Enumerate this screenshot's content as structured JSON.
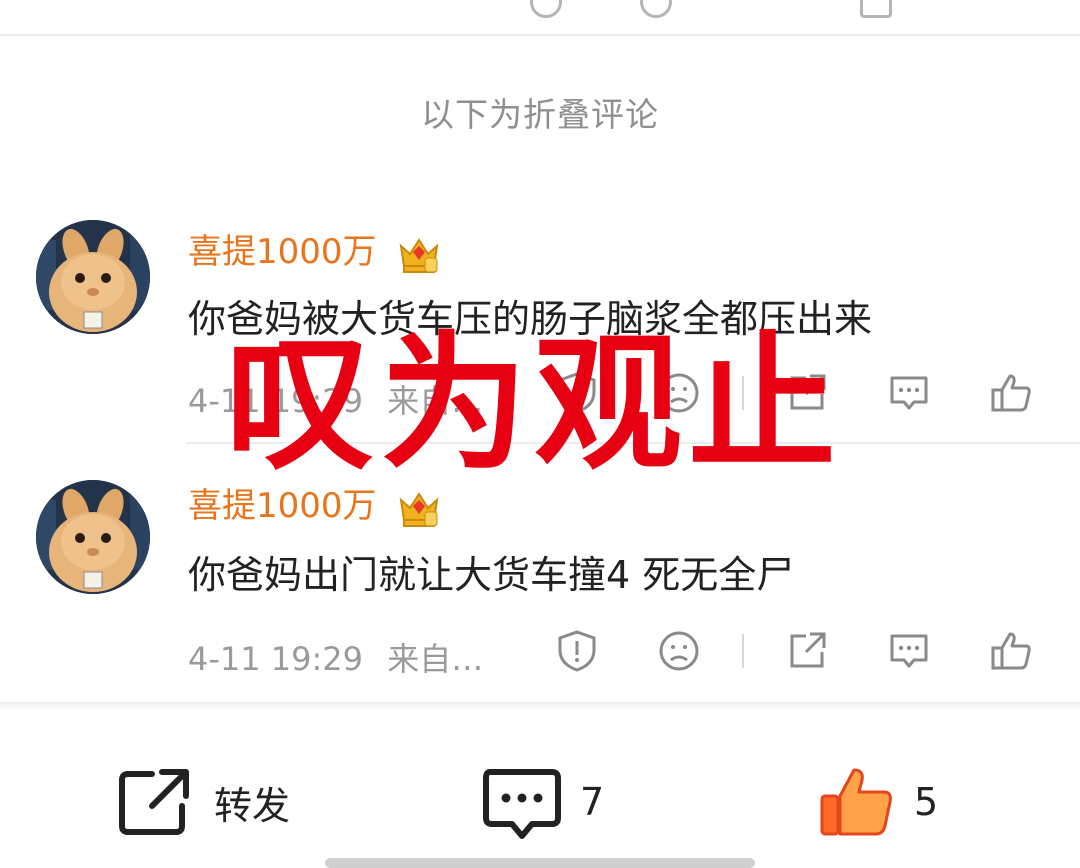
{
  "folded_notice": "以下为折叠评论",
  "watermark": "叹为观止",
  "comments": [
    {
      "username": "喜提1000万",
      "text": "你爸妈被大货车压的肠子脑浆全都压出来",
      "time": "4-11 19:29",
      "source": "来自…"
    },
    {
      "username": "喜提1000万",
      "text": "你爸妈出门就让大货车撞4 死无全尸",
      "time": "4-11 19:29",
      "source": "来自…"
    }
  ],
  "bottom_bar": {
    "repost_label": "转发",
    "comment_count": "7",
    "like_count": "5"
  },
  "colors": {
    "username": "#e8741c",
    "watermark": "#e60012",
    "like_active": "#ff6a2a"
  },
  "icons": [
    "report-icon",
    "dislike-icon",
    "share-icon",
    "comment-icon",
    "like-icon",
    "crown-badge-icon"
  ]
}
